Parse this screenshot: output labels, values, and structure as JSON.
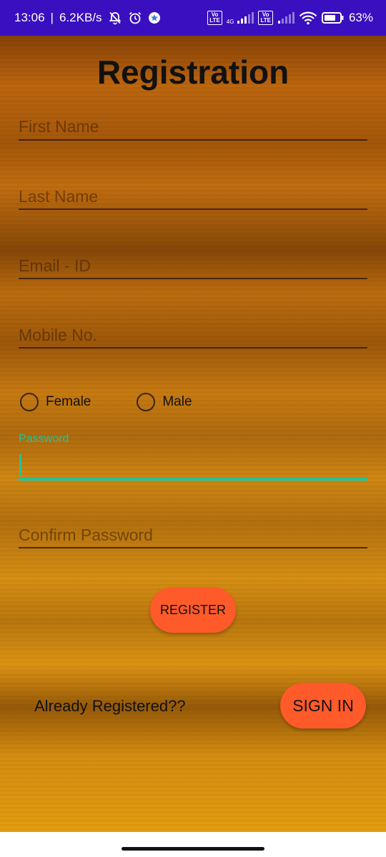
{
  "status_bar": {
    "time": "13:06",
    "separator": "|",
    "speed": "6.2KB/s",
    "network_gen": "4G",
    "sim1_badge": "Vo\nLTE",
    "sim2_badge": "Vo\nLTE",
    "battery": "63%",
    "icons": [
      "bell-off-icon",
      "alarm-icon",
      "app-notification-icon",
      "volte-icon",
      "signal-icon",
      "wifi-icon",
      "battery-icon"
    ]
  },
  "form": {
    "title": "Registration",
    "first_name_placeholder": "First Name",
    "last_name_placeholder": "Last Name",
    "email_placeholder": "Email - ID",
    "mobile_placeholder": "Mobile No.",
    "gender_options": [
      "Female",
      "Male"
    ],
    "password_label": "Password",
    "password_value": "",
    "confirm_password_placeholder": "Confirm Password",
    "register_label": "REGISTER",
    "already_registered": "Already Registered??",
    "signin_label": "SIGN IN"
  },
  "colors": {
    "status_bar": "#3a0fbf",
    "accent_focus": "#1fc59a",
    "button": "#ff5a2a"
  }
}
